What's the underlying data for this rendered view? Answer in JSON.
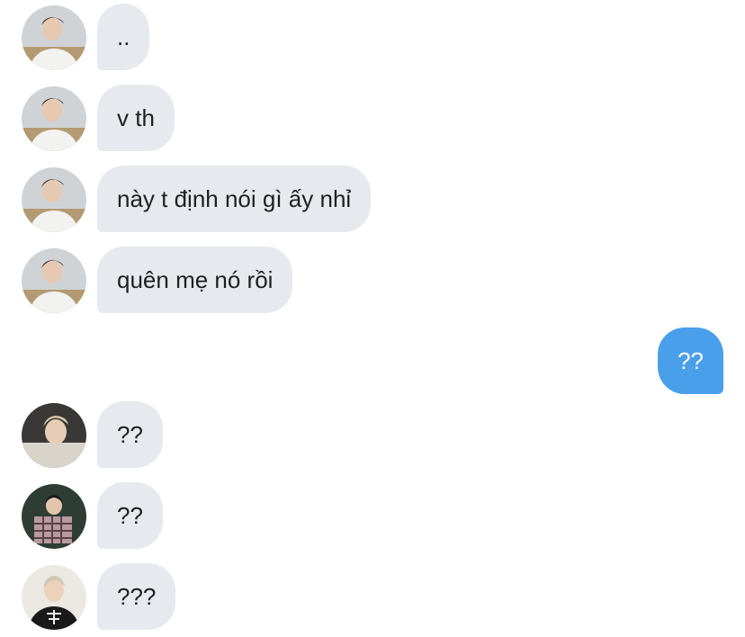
{
  "messages": [
    {
      "direction": "received",
      "sender_avatar": "avatar-user-a",
      "text": ".."
    },
    {
      "direction": "received",
      "sender_avatar": "avatar-user-a",
      "text": "v th"
    },
    {
      "direction": "received",
      "sender_avatar": "avatar-user-a",
      "text": "này t định nói gì ấy nhỉ"
    },
    {
      "direction": "received",
      "sender_avatar": "avatar-user-a",
      "text": "quên mẹ nó rồi"
    },
    {
      "direction": "sent",
      "text": "??"
    },
    {
      "direction": "received",
      "sender_avatar": "avatar-user-b",
      "text": "??"
    },
    {
      "direction": "received",
      "sender_avatar": "avatar-user-c",
      "text": "??"
    },
    {
      "direction": "received",
      "sender_avatar": "avatar-user-d",
      "text": "???"
    }
  ],
  "colors": {
    "received_bubble": "#e6eaef",
    "sent_bubble": "#4a9feb",
    "received_text": "#1f1f1f",
    "sent_text": "#ffffff"
  }
}
